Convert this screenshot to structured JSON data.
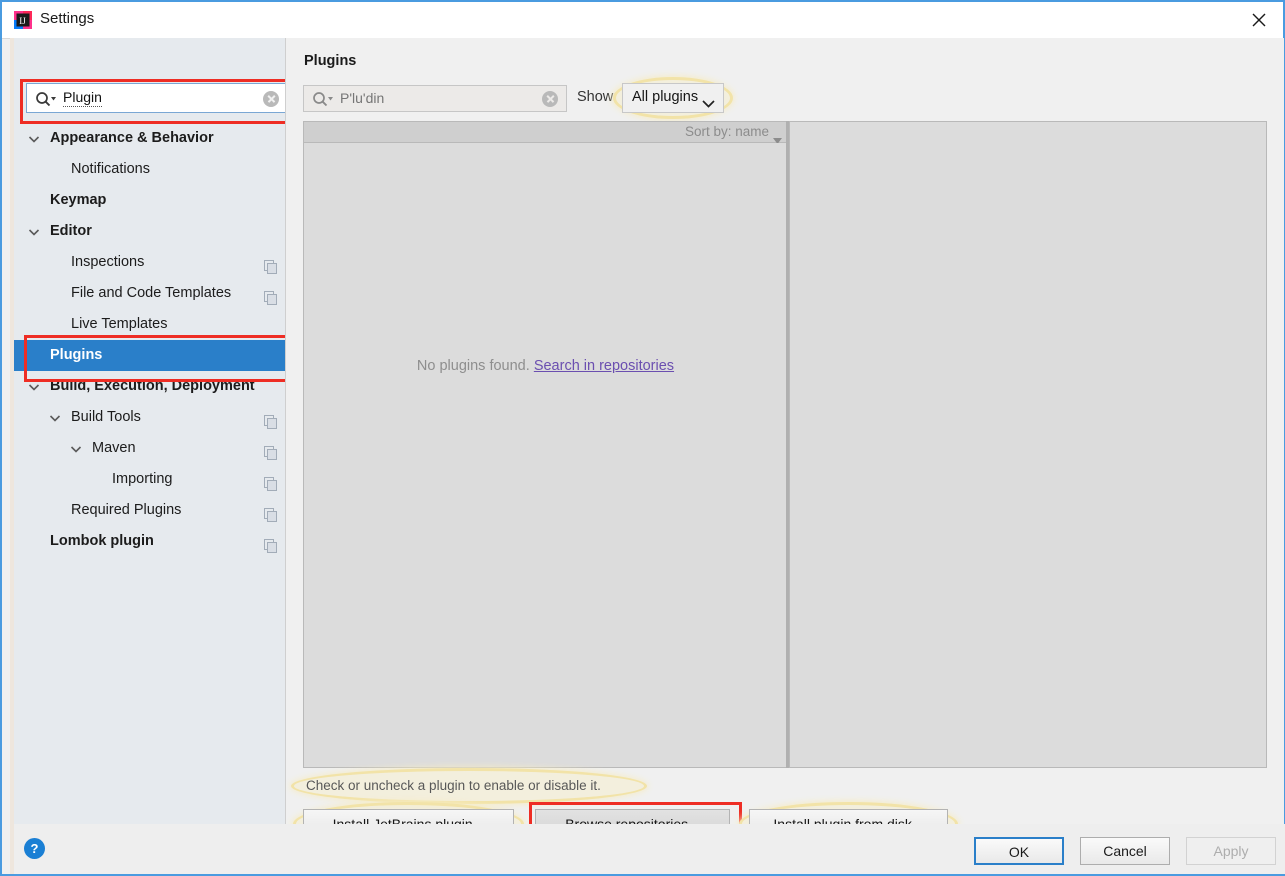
{
  "window": {
    "title": "Settings",
    "app_icon": "intellij-idea-icon",
    "close_icon": "close-icon"
  },
  "sidebar": {
    "search": {
      "value": "Plugin",
      "search_icon": "search-icon",
      "clear_icon": "clear-icon"
    },
    "items": [
      {
        "label": "Appearance & Behavior",
        "indent": 36,
        "bold": true,
        "chevron": true,
        "copy": false,
        "selected": false
      },
      {
        "label": "Notifications",
        "indent": 57,
        "bold": false,
        "chevron": false,
        "copy": false,
        "selected": false
      },
      {
        "label": "Keymap",
        "indent": 36,
        "bold": true,
        "chevron": false,
        "copy": false,
        "selected": false
      },
      {
        "label": "Editor",
        "indent": 36,
        "bold": true,
        "chevron": true,
        "copy": false,
        "selected": false
      },
      {
        "label": "Inspections",
        "indent": 57,
        "bold": false,
        "chevron": false,
        "copy": true,
        "selected": false
      },
      {
        "label": "File and Code Templates",
        "indent": 57,
        "bold": false,
        "chevron": false,
        "copy": true,
        "selected": false
      },
      {
        "label": "Live Templates",
        "indent": 57,
        "bold": false,
        "chevron": false,
        "copy": false,
        "selected": false
      },
      {
        "label": "Plugins",
        "indent": 36,
        "bold": true,
        "chevron": false,
        "copy": false,
        "selected": true
      },
      {
        "label": "Build, Execution, Deployment",
        "indent": 36,
        "bold": true,
        "chevron": true,
        "copy": false,
        "selected": false
      },
      {
        "label": "Build Tools",
        "indent": 57,
        "bold": false,
        "chevron": true,
        "copy": true,
        "selected": false
      },
      {
        "label": "Maven",
        "indent": 78,
        "bold": false,
        "chevron": true,
        "copy": true,
        "selected": false
      },
      {
        "label": "Importing",
        "indent": 98,
        "bold": false,
        "chevron": false,
        "copy": true,
        "selected": false
      },
      {
        "label": "Required Plugins",
        "indent": 57,
        "bold": false,
        "chevron": false,
        "copy": true,
        "selected": false
      },
      {
        "label": "Lombok plugin",
        "indent": 36,
        "bold": true,
        "chevron": false,
        "copy": true,
        "selected": false
      }
    ]
  },
  "main": {
    "title": "Plugins",
    "plugin_search": {
      "placeholder": "P'lu'din",
      "search_icon": "search-icon",
      "clear_icon": "clear-icon"
    },
    "show_label": "Show:",
    "show_value": "All plugins",
    "show_options": [
      "All plugins"
    ],
    "sort_by": "Sort by: name",
    "empty_message": "No plugins found.",
    "empty_link": "Search in repositories",
    "hint": "Check or uncheck a plugin to enable or disable it.",
    "buttons": {
      "install_jetbrains": "Install JetBrains plugin...",
      "browse_repositories": "Browse repositories...",
      "install_from_disk": "Install plugin from disk..."
    }
  },
  "footer": {
    "help_icon": "help-icon",
    "help_glyph": "?",
    "ok": "OK",
    "cancel": "Cancel",
    "apply": "Apply"
  },
  "colors": {
    "selection_blue": "#2a7fc9",
    "highlight_red": "#ee2d24",
    "highlight_yellow": "#f2e3a8",
    "link_purple": "#6b4fb0",
    "window_border": "#4a9be0"
  }
}
